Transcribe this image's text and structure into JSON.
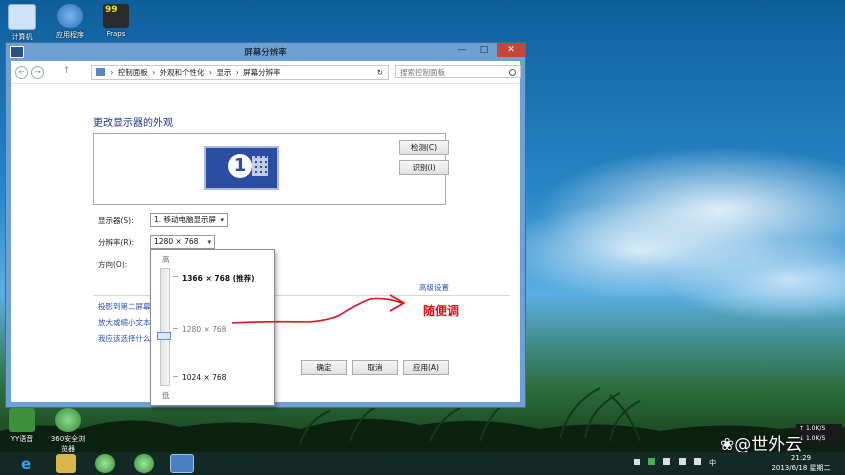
{
  "desktop": {
    "icons": [
      {
        "label": "计算机",
        "color": "#cfe3f7"
      },
      {
        "label": "应用程序",
        "color": "#3a7fd0"
      },
      {
        "label": "Fraps",
        "badge": "99",
        "color": "#2b2b2b"
      },
      {
        "label": "YY语音",
        "color": "#3e8f3e"
      },
      {
        "label": "360安全浏览器",
        "color": "#4aa34a"
      }
    ]
  },
  "window": {
    "title": "屏幕分辨率",
    "minimize_glyph": "—",
    "maximize_glyph": "□",
    "close_glyph": "✕",
    "nav": {
      "back": "←",
      "forward": "→",
      "up": "↑"
    },
    "breadcrumb": [
      "控制面板",
      "外观和个性化",
      "显示",
      "屏幕分辨率"
    ],
    "breadcrumb_sep": "›",
    "refresh_glyph": "↻",
    "search_placeholder": "搜索控制面板",
    "heading": "更改显示器的外观",
    "monitor_number": "1",
    "detect_button": "检测(C)",
    "identify_button": "识别(I)",
    "display_label": "显示器(S):",
    "display_value": "1. 移动电脑显示屏",
    "resolution_label": "分辨率(R):",
    "resolution_value": "1280 × 768",
    "orientation_label": "方向(O):",
    "advanced_link": "高级设置",
    "links": [
      "投影到第二屏幕",
      "放大或缩小文本",
      "我应该选择什么"
    ],
    "ok_button": "确定",
    "cancel_button": "取消",
    "apply_button": "应用(A)",
    "dropdown_arrow": "▾"
  },
  "resolution_popup": {
    "high_label": "高",
    "low_label": "低",
    "options": [
      {
        "label": "1366 × 768 (推荐)",
        "bold": true
      },
      {
        "label": "1280 × 768",
        "bold": false
      },
      {
        "label": "1024 × 768",
        "bold": false
      }
    ],
    "selected_fraction": 0.58
  },
  "annotation": {
    "text": "随便调",
    "color": "#e0121b"
  },
  "taskbar": {
    "clock_time": "21:29",
    "clock_date": "2013/6/18 星期二",
    "ime": "中",
    "net_up": "1.0K/S",
    "net_down": "1.0K/S",
    "net_glyph_up": "↑",
    "net_glyph_down": "↓"
  },
  "watermark": "❀@世外云"
}
